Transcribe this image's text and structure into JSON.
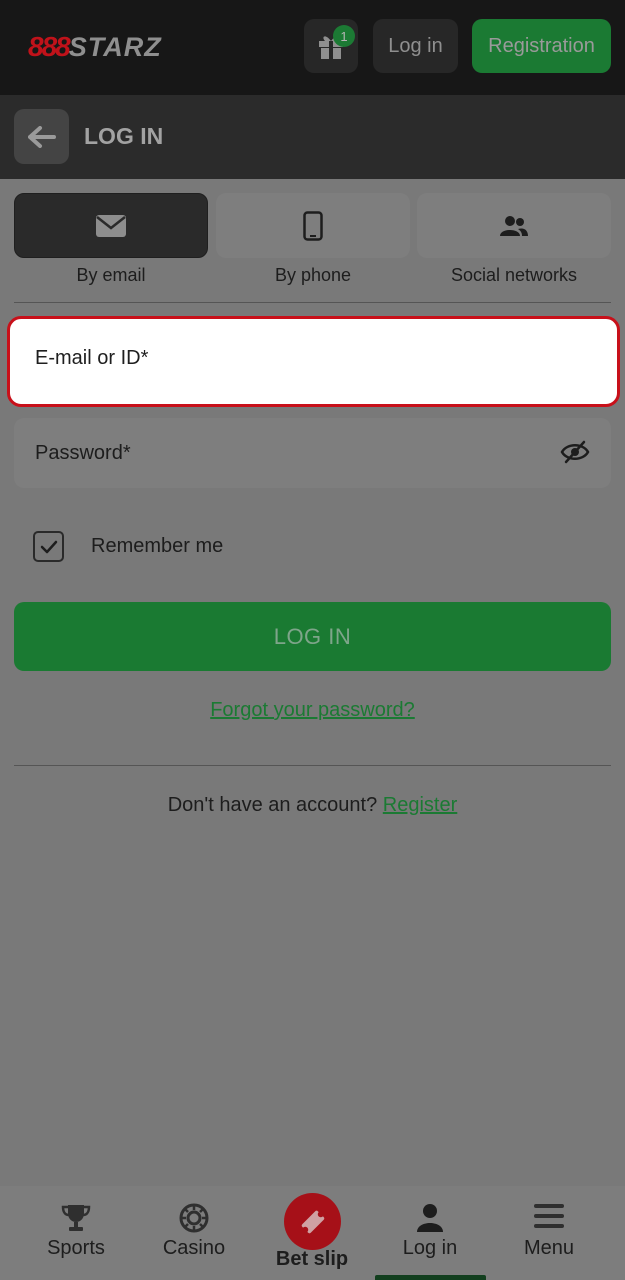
{
  "header": {
    "logo_mark": "888",
    "logo_text": "STARZ",
    "gift_badge": "1",
    "login_label": "Log in",
    "register_label": "Registration"
  },
  "subheader": {
    "title": "LOG IN"
  },
  "tabs": [
    {
      "label": "By email",
      "icon": "envelope-icon",
      "active": true
    },
    {
      "label": "By phone",
      "icon": "phone-icon",
      "active": false
    },
    {
      "label": "Social networks",
      "icon": "users-icon",
      "active": false
    }
  ],
  "form": {
    "email_placeholder": "E-mail or ID*",
    "password_placeholder": "Password*",
    "remember_label": "Remember me",
    "remember_checked": true,
    "submit_label": "LOG IN",
    "forgot_label": "Forgot your password?",
    "no_account_text": "Don't have an account?",
    "register_link": "Register"
  },
  "bottom_nav": [
    {
      "label": "Sports",
      "icon": "trophy-icon"
    },
    {
      "label": "Casino",
      "icon": "casino-chip-icon"
    },
    {
      "label": "Bet slip",
      "icon": "ticket-icon"
    },
    {
      "label": "Log in",
      "icon": "user-icon",
      "active": true
    },
    {
      "label": "Menu",
      "icon": "hamburger-icon"
    }
  ],
  "colors": {
    "brand_green": "#1b7a33",
    "brand_red": "#c8101a",
    "overlay_gray": "#797979"
  }
}
